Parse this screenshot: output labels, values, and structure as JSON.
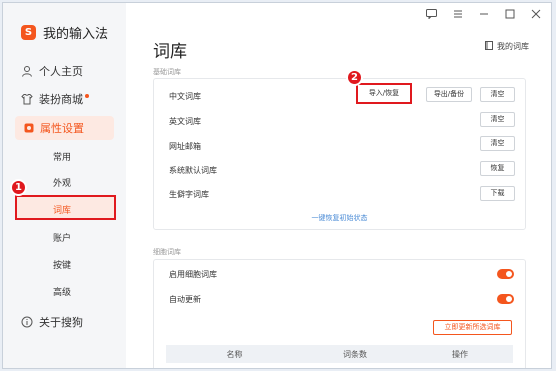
{
  "app": {
    "name": "我的输入法",
    "logo_glyph": "S",
    "brand_color": "#f4561e"
  },
  "sidebar": {
    "items": [
      {
        "label": "个人主页",
        "icon": "user-icon"
      },
      {
        "label": "装扮商城",
        "icon": "shirt-icon"
      },
      {
        "label": "属性设置",
        "icon": "gear-icon"
      },
      {
        "label": "关于搜狗",
        "icon": "info-icon"
      }
    ],
    "subitems": [
      {
        "label": "常用"
      },
      {
        "label": "外观"
      },
      {
        "label": "词库"
      },
      {
        "label": "账户"
      },
      {
        "label": "按键"
      },
      {
        "label": "高级"
      }
    ]
  },
  "header": {
    "title": "词库",
    "my_dict": "我的词库"
  },
  "basic_section": {
    "label": "基础词库",
    "rows": [
      {
        "label": "中文词库"
      },
      {
        "label": "英文词库"
      },
      {
        "label": "网址邮箱"
      },
      {
        "label": "系统默认词库"
      },
      {
        "label": "生僻字词库"
      }
    ],
    "buttons": {
      "import": "导入/恢复",
      "export": "导出/备份",
      "clear1": "清空",
      "clear2": "清空",
      "clear3": "清空",
      "restore": "恢复",
      "download": "下载"
    },
    "restore_link": "一键恢复初始状态"
  },
  "cell_section": {
    "label": "细胞词库",
    "rows": [
      {
        "label": "启用细胞词库"
      },
      {
        "label": "自动更新"
      }
    ],
    "update_btn": "立即更新所选词库",
    "table_headers": [
      "名称",
      "词条数",
      "操作"
    ]
  },
  "badges": {
    "one": "1",
    "two": "2"
  }
}
